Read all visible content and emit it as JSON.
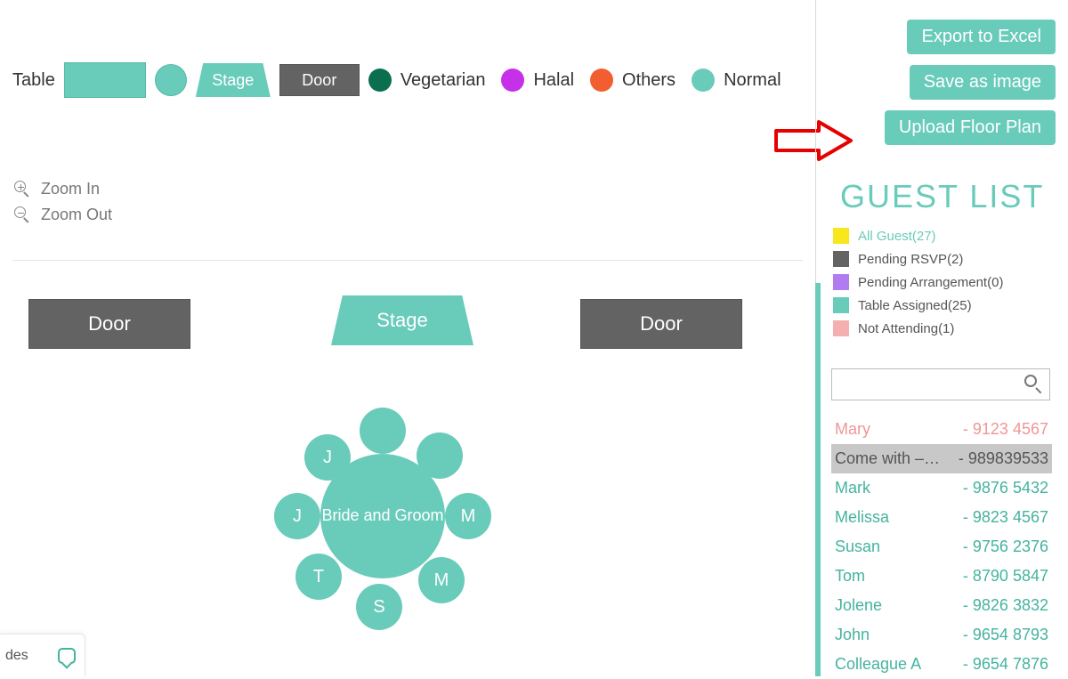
{
  "toolbar": {
    "table_label": "Table",
    "stage_label": "Stage",
    "door_label": "Door",
    "diet": {
      "vegetarian": "Vegetarian",
      "halal": "Halal",
      "others": "Others",
      "normal": "Normal"
    }
  },
  "zoom": {
    "in": "Zoom In",
    "out": "Zoom Out"
  },
  "floor": {
    "door": "Door",
    "stage": "Stage",
    "main_table": "Bride and Groom",
    "seats": [
      "",
      "J",
      "J",
      "T",
      "S",
      "M",
      "M",
      ""
    ]
  },
  "sidebar": {
    "buttons": {
      "export": "Export to Excel",
      "save_image": "Save as image",
      "upload": "Upload Floor Plan"
    },
    "guest_title": "GUEST LIST",
    "filters": [
      {
        "label": "All Guest(27)",
        "color": "#F8E71C",
        "active": true
      },
      {
        "label": "Pending RSVP(2)",
        "color": "#636363",
        "active": false
      },
      {
        "label": "Pending Arrangement(0)",
        "color": "#B07CF0",
        "active": false
      },
      {
        "label": "Table Assigned(25)",
        "color": "#69CBBA",
        "active": false
      },
      {
        "label": "Not Attending(1)",
        "color": "#F4B0B0",
        "active": false
      }
    ],
    "search": {
      "placeholder": ""
    },
    "guests": [
      {
        "name": "Mary",
        "phone": "- 9123 4567",
        "style": "pink"
      },
      {
        "name": "Come with –…",
        "phone": "- 989839533",
        "style": "grey"
      },
      {
        "name": "Mark",
        "phone": "- 9876 5432",
        "style": "teal"
      },
      {
        "name": "Melissa",
        "phone": "- 9823 4567",
        "style": "teal"
      },
      {
        "name": "Susan",
        "phone": "- 9756 2376",
        "style": "teal"
      },
      {
        "name": "Tom",
        "phone": "- 8790 5847",
        "style": "teal"
      },
      {
        "name": "Jolene",
        "phone": "- 9826 3832",
        "style": "teal"
      },
      {
        "name": "John",
        "phone": "- 9654 8793",
        "style": "teal"
      },
      {
        "name": "Colleague A",
        "phone": "- 9654 7876",
        "style": "teal"
      }
    ]
  },
  "chat_stub": "des"
}
